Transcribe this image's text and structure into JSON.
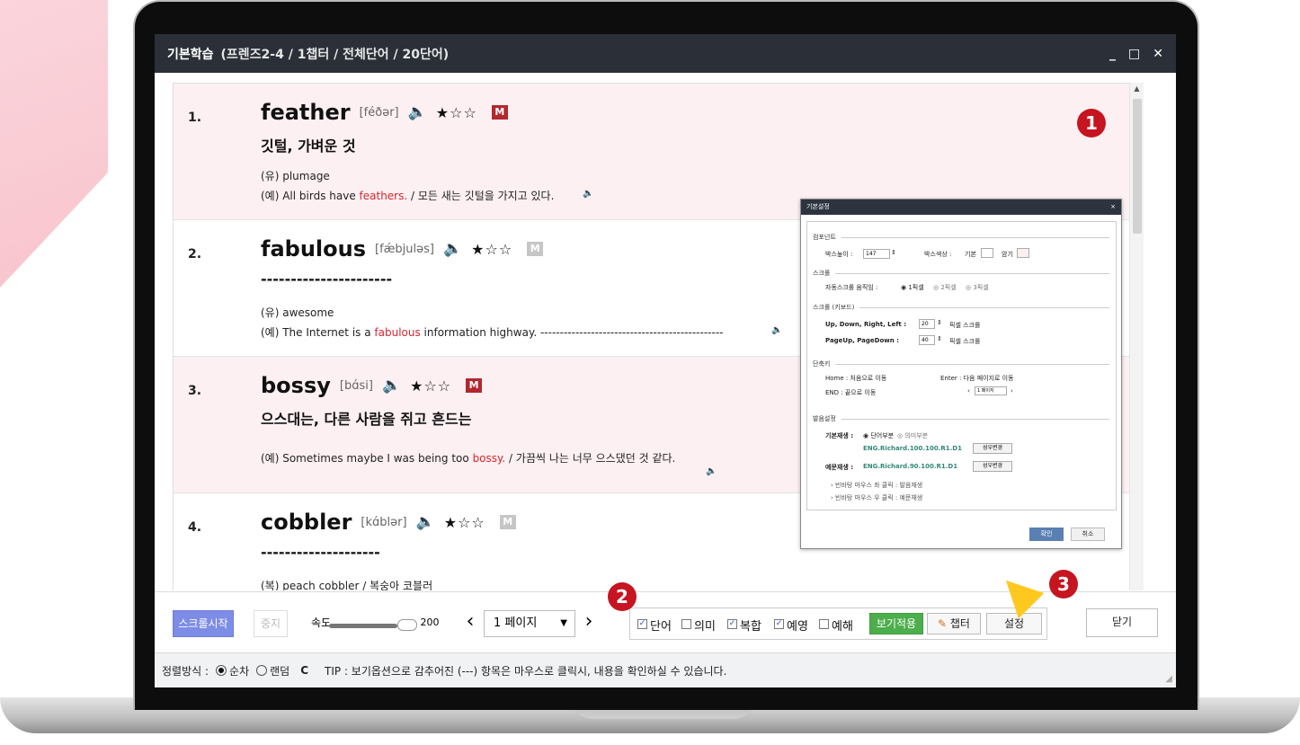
{
  "window": {
    "title": "기본학습",
    "subtitle": "(프렌즈2-4 / 1챕터 / 전체단어 / 20단어)",
    "controls": [
      "_",
      "□",
      "✕"
    ]
  },
  "entries": [
    {
      "num": "1.",
      "word": "feather",
      "pron": "[féðər]",
      "stars": "★☆☆",
      "m_label": "M",
      "meaning": "깃털, 가벼운 것",
      "syn": "(유) plumage",
      "ex_prefix": "(예) All birds have ",
      "ex_hl": "feathers.",
      "ex_suffix": "  / 모든 새는 깃털을 가지고 있다."
    },
    {
      "num": "2.",
      "word": "fabulous",
      "pron": "[fǽbjuləs]",
      "stars": "★☆☆",
      "m_label": "M",
      "meaning": "----------------------",
      "syn": "(유) awesome",
      "ex_prefix": "(예) The Internet is a ",
      "ex_hl": "fabulous",
      "ex_suffix": " information highway. -----------------------------------------------"
    },
    {
      "num": "3.",
      "word": "bossy",
      "pron": "[bɑ́si]",
      "stars": "★☆☆",
      "m_label": "M",
      "meaning": "으스대는, 다른 사람을 쥐고 흔드는",
      "ex_prefix": "(예) Sometimes maybe I was being too ",
      "ex_hl": "bossy.",
      "ex_suffix": "  / 가끔씩 나는 너무 으스댔던 것 같다."
    },
    {
      "num": "4.",
      "word": "cobbler",
      "pron": "[kɑ́blər]",
      "stars": "★☆☆",
      "m_label": "M",
      "meaning": "--------------------",
      "compound": "(복) peach cobbler / 복숭아 코블러"
    }
  ],
  "callouts": [
    "1",
    "2",
    "3"
  ],
  "dialog": {
    "title": "기본설정",
    "close": "×",
    "sec_component": "컴포넌트",
    "box_height_label": "박스높이 :",
    "box_height_value": "147",
    "box_color_label": "박스색상 :",
    "color_default": "기본",
    "color_dark": "암기",
    "sec_scroll": "스크롤",
    "auto_scroll_label": "자동스크롤 움직임 :",
    "scroll_opt1": "1픽셀",
    "scroll_opt2": "2픽셀",
    "scroll_opt3": "3픽셀",
    "sec_scroll_kb": "스크롤 (키보드)",
    "udrl_label": "Up, Down, Right, Left :",
    "udrl_value": "20",
    "pixel_scroll": "픽셀 스크롤",
    "pgupdn_label": "PageUp, PageDown :",
    "pgupdn_value": "40",
    "sec_shortcut": "단축키",
    "home_text": "Home : 처음으로 이동",
    "enter_text": "Enter : 다음 페이지로 이동",
    "end_text": "END :  끝으로 이동",
    "page_sel": "1 페이지",
    "sec_pron": "발음설정",
    "basic_play_label": "기본재생 :",
    "opt_word": "단어부분",
    "opt_meaning": "의미부분",
    "voice1": "ENG.Richard.100.100.R1.D1",
    "change_voice": "성우변경",
    "ex_play_label": "예문재생 :",
    "voice2": "ENG.Richard.90.100.R1.D1",
    "hint1": "› 빈바탕 마우스 좌 클릭 : 발음재생",
    "hint2": "› 빈바탕 마우스 우 클릭 : 예문재생",
    "ok": "확인",
    "cancel": "취소"
  },
  "toolbar": {
    "scroll_start": "스크롤시작",
    "stop": "중지",
    "speed_label": "속도",
    "speed_value": "200",
    "speed_fill": 0.9,
    "prev": "‹",
    "page": "1 페이지",
    "page_caret": "▼",
    "next": "›",
    "options": [
      {
        "label": "단어",
        "checked": true
      },
      {
        "label": "의미",
        "checked": false
      },
      {
        "label": "복합",
        "checked": true
      },
      {
        "label": "예영",
        "checked": true
      },
      {
        "label": "예해",
        "checked": false
      }
    ],
    "apply": "보기적용",
    "chapter": "챕터",
    "settings": "설정",
    "close": "닫기"
  },
  "status": {
    "sort_label": "정렬방식 :",
    "sequential": "순차",
    "random": "랜덤",
    "refresh": "C",
    "tip": "TIP : 보기옵션으로 감추어진 (---) 항목은 마우스로 클릭시, 내용을 확인하실 수 있습니다."
  }
}
